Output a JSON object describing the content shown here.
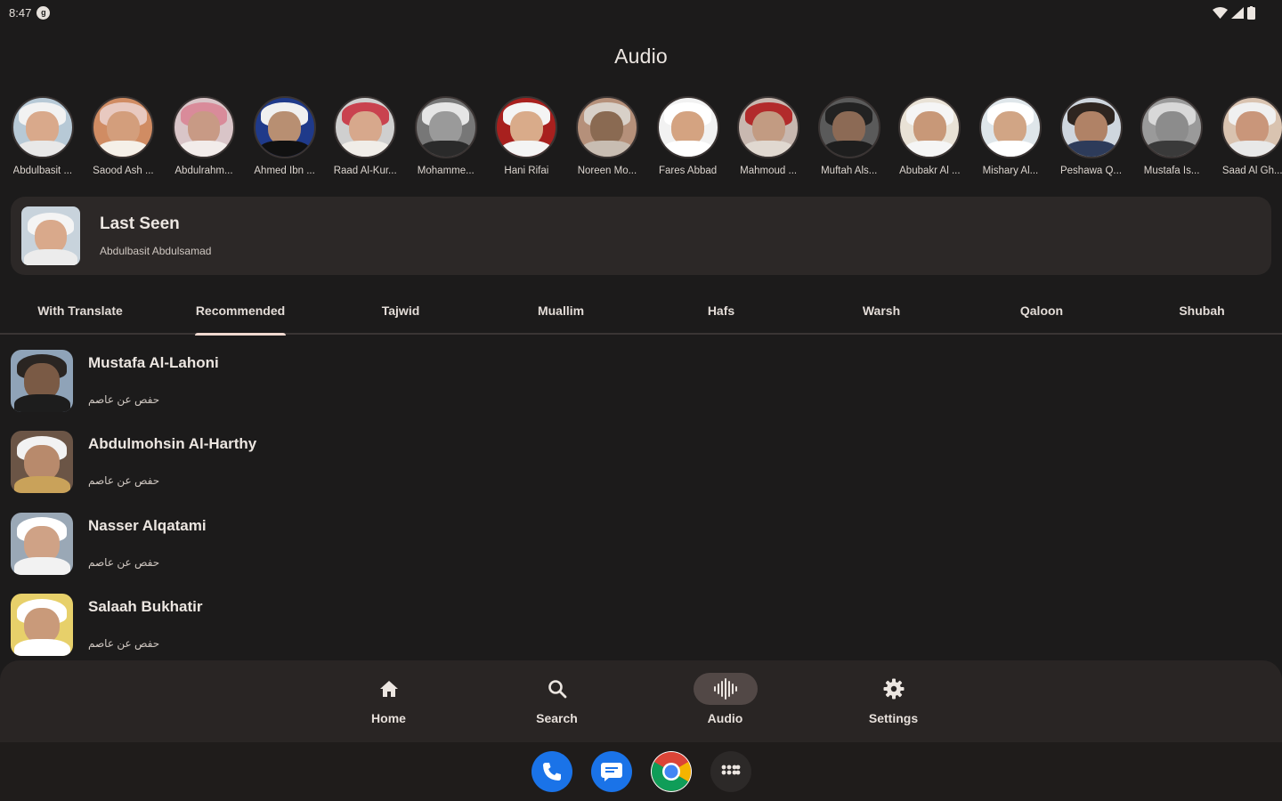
{
  "status": {
    "time": "8:47",
    "notification_icon": "g"
  },
  "app_title": "Audio",
  "reciters": [
    {
      "name": "Abdulbasit ...",
      "bg": "#b7c9d6",
      "face": "#d9a98b",
      "head": "#f2f2f2",
      "body": "#e8e8e8"
    },
    {
      "name": "Saood Ash ...",
      "bg": "#d08c63",
      "face": "#d39e7c",
      "head": "#e8c9c0",
      "body": "#f5f0e8"
    },
    {
      "name": "Abdulrahm...",
      "bg": "#d9c5c8",
      "face": "#c89a85",
      "head": "#d98b9a",
      "body": "#f2ecea"
    },
    {
      "name": "Ahmed Ibn ...",
      "bg": "#1f3a8a",
      "face": "#b88f72",
      "head": "#f0f0f0",
      "body": "#111111"
    },
    {
      "name": "Raad Al-Kur...",
      "bg": "#cfcfcf",
      "face": "#d7a88c",
      "head": "#c9424f",
      "body": "#f0ede8"
    },
    {
      "name": "Mohamme...",
      "bg": "#777777",
      "face": "#9a9a9a",
      "head": "#e5e5e5",
      "body": "#2a2a2a"
    },
    {
      "name": "Hani Rifai",
      "bg": "#a8201e",
      "face": "#d9ab8a",
      "head": "#f4f4f4",
      "body": "#f4f4f4"
    },
    {
      "name": "Noreen Mo...",
      "bg": "#b5907a",
      "face": "#8a6a52",
      "head": "#d8d0c8",
      "body": "#c8bdb2"
    },
    {
      "name": "Fares Abbad",
      "bg": "#f2f2f2",
      "face": "#d4a381",
      "head": "#ffffff",
      "body": "#ffffff"
    },
    {
      "name": "Mahmoud ...",
      "bg": "#c8b8b0",
      "face": "#c29b82",
      "head": "#b22b2b",
      "body": "#e0d8d0"
    },
    {
      "name": "Muftah Als...",
      "bg": "#5a5a5a",
      "face": "#8c6a55",
      "head": "#222222",
      "body": "#1e1e1e"
    },
    {
      "name": "Abubakr Al ...",
      "bg": "#e9e2d6",
      "face": "#c89878",
      "head": "#f5f5f5",
      "body": "#f5f5f5"
    },
    {
      "name": "Mishary Al...",
      "bg": "#dfe6ea",
      "face": "#d1a585",
      "head": "#ffffff",
      "body": "#ffffff"
    },
    {
      "name": "Peshawa Q...",
      "bg": "#cfd6de",
      "face": "#b08266",
      "head": "#2e2520",
      "body": "#2d3b5a"
    },
    {
      "name": "Mustafa Is...",
      "bg": "#9a9a9a",
      "face": "#8c8c8c",
      "head": "#d8d8d8",
      "body": "#3a3a3a"
    },
    {
      "name": "Saad Al Gh...",
      "bg": "#d9c3b0",
      "face": "#c9967a",
      "head": "#f0f0f0",
      "body": "#e8e8e8"
    }
  ],
  "last_seen": {
    "title": "Last Seen",
    "subtitle": "Abdulbasit Abdulsamad"
  },
  "tabs": [
    {
      "label": "With Translate",
      "active": false
    },
    {
      "label": "Recommended",
      "active": true
    },
    {
      "label": "Tajwid",
      "active": false
    },
    {
      "label": "Muallim",
      "active": false
    },
    {
      "label": "Hafs",
      "active": false
    },
    {
      "label": "Warsh",
      "active": false
    },
    {
      "label": "Qaloon",
      "active": false
    },
    {
      "label": "Shubah",
      "active": false
    }
  ],
  "list": [
    {
      "name": "Mustafa Al-Lahoni",
      "sub": "حفص عن عاصم",
      "bg": "#8fa3b8",
      "face": "#7a5a45",
      "head": "#2a2522",
      "body": "#1d1d1d"
    },
    {
      "name": "Abdulmohsin Al-Harthy",
      "sub": "حفص عن عاصم",
      "bg": "#6b5546",
      "face": "#b88a6c",
      "head": "#f2f2f2",
      "body": "#c9a25a"
    },
    {
      "name": "Nasser Alqatami",
      "sub": "حفص عن عاصم",
      "bg": "#9aa8b6",
      "face": "#cfa286",
      "head": "#ffffff",
      "body": "#f2f2f2"
    },
    {
      "name": "Salaah Bukhatir",
      "sub": "حفص عن عاصم",
      "bg": "#e7d06a",
      "face": "#c99a7a",
      "head": "#ffffff",
      "body": "#ffffff"
    }
  ],
  "nav": [
    {
      "label": "Home",
      "icon": "home-icon",
      "active": false
    },
    {
      "label": "Search",
      "icon": "search-icon",
      "active": false
    },
    {
      "label": "Audio",
      "icon": "audio-wave-icon",
      "active": true
    },
    {
      "label": "Settings",
      "icon": "settings-icon",
      "active": false
    }
  ],
  "dock": [
    {
      "icon": "phone-icon",
      "color": "#1a73e8"
    },
    {
      "icon": "messages-icon",
      "color": "#1a73e8"
    },
    {
      "icon": "chrome-icon",
      "color": "#ffffff"
    },
    {
      "icon": "app-drawer-icon",
      "color": "#2c2928"
    }
  ]
}
